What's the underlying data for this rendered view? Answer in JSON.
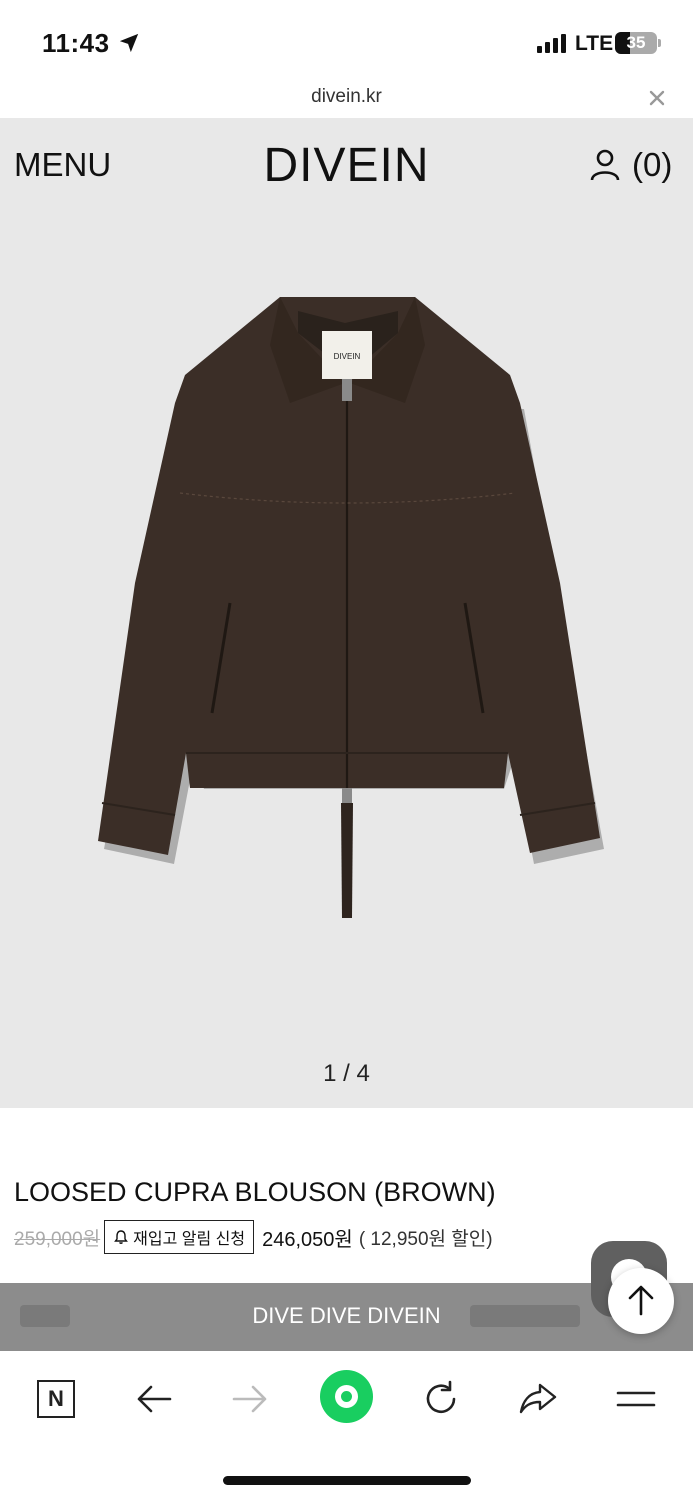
{
  "status_bar": {
    "time": "11:43",
    "network": "LTE",
    "battery_percent": "35",
    "battery_level": 0.35
  },
  "browser": {
    "url": "divein.kr"
  },
  "header": {
    "menu_label": "MENU",
    "brand": "DIVEIN",
    "cart_count": "(0)"
  },
  "gallery": {
    "counter": "1 / 4",
    "image_label": "DIVEIN",
    "jacket_color": "#3b2e27"
  },
  "product": {
    "name": "LOOSED CUPRA BLOUSON (BROWN)",
    "original_price": "259,000원",
    "restock_label": "재입고 알림 신청",
    "sale_price": "246,050원",
    "discount": "( 12,950원 할인)"
  },
  "promo": {
    "text": "DIVE DIVE DIVEIN"
  },
  "toolbar": {
    "naver_label": "N",
    "icons": [
      "naver-icon",
      "back-arrow-icon",
      "forward-arrow-icon",
      "green-home-icon",
      "reload-icon",
      "share-icon",
      "menu-icon"
    ]
  },
  "colors": {
    "hero_bg": "#e8e8e8",
    "promo_bg": "#8c8c8c",
    "accent_green": "#19ce60"
  }
}
